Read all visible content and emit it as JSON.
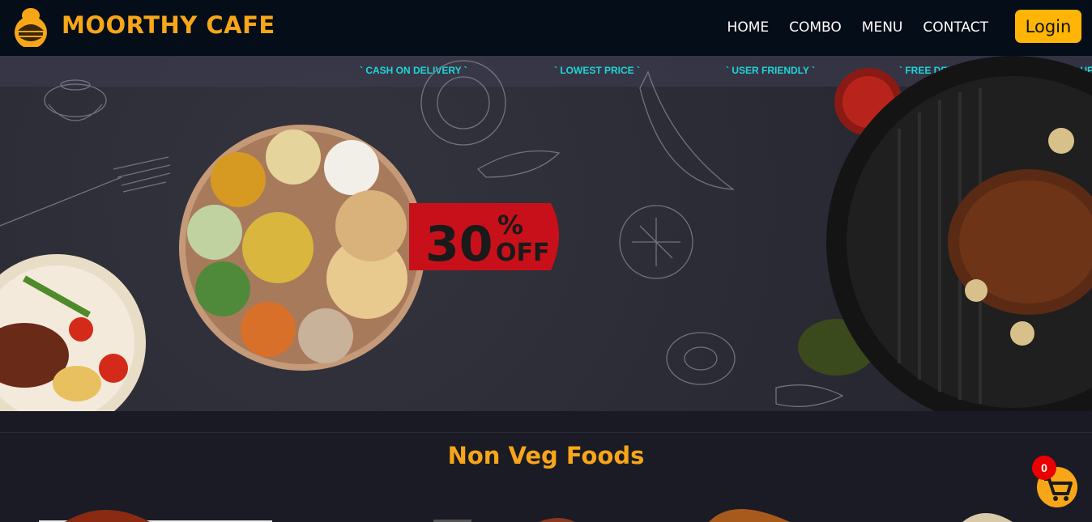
{
  "brand": {
    "name": "MOORTHY CAFE",
    "logo_icon": "chef-burger-icon"
  },
  "nav": {
    "items": [
      {
        "label": "HOME"
      },
      {
        "label": "COMBO"
      },
      {
        "label": "MENU"
      },
      {
        "label": "CONTACT"
      }
    ],
    "login_label": "Login"
  },
  "ticker": {
    "items": [
      "` CASH ON DELIVERY `",
      "` LOWEST PRICE `",
      "` USER FRIENDLY `",
      "` FREE DELIVERY `",
      "` UP"
    ]
  },
  "hero": {
    "offer_value": "30",
    "offer_percent": "%",
    "offer_word": "OFF"
  },
  "section": {
    "title": "Non Veg Foods"
  },
  "cart": {
    "count": "0",
    "icon": "shopping-cart-icon"
  },
  "colors": {
    "accent": "#f7a618",
    "navbar": "#050d18",
    "ticker_text": "#1fd6d6",
    "badge": "#e80000",
    "offer_red": "#c8101a"
  }
}
